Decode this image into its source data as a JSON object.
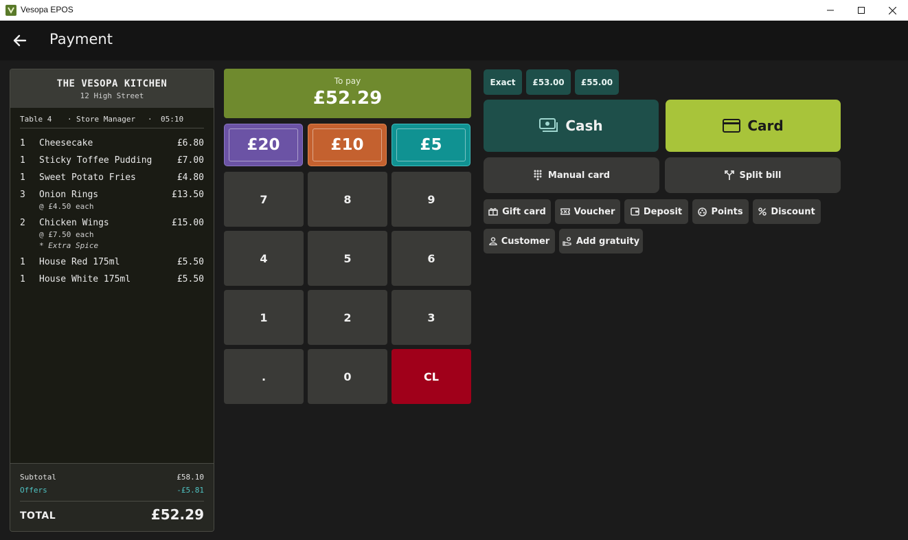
{
  "window": {
    "title": "Vesopa EPOS"
  },
  "header": {
    "title": "Payment"
  },
  "receipt": {
    "restaurant": "THE VESOPA KITCHEN",
    "address": "12 High Street",
    "table": "Table 4",
    "separator": "·",
    "staff": "Store Manager",
    "time": "05:10",
    "items": [
      {
        "qty": "1",
        "name": "Cheesecake",
        "price": "£6.80"
      },
      {
        "qty": "1",
        "name": "Sticky Toffee Pudding",
        "price": "£7.00"
      },
      {
        "qty": "1",
        "name": "Sweet Potato Fries",
        "price": "£4.80"
      },
      {
        "qty": "3",
        "name": "Onion Rings",
        "price": "£13.50",
        "each": "@ £4.50 each"
      },
      {
        "qty": "2",
        "name": "Chicken Wings",
        "price": "£15.00",
        "each": "@ £7.50 each",
        "modifier": "* Extra Spice"
      },
      {
        "qty": "1",
        "name": "House Red 175ml",
        "price": "£5.50"
      },
      {
        "qty": "1",
        "name": "House White 175ml",
        "price": "£5.50"
      }
    ],
    "subtotal_label": "Subtotal",
    "subtotal": "£58.10",
    "offers_label": "Offers",
    "offers": "-£5.81",
    "total_label": "TOTAL",
    "total": "£52.29"
  },
  "to_pay": {
    "label": "To pay",
    "amount": "£52.29"
  },
  "notes": [
    "£20",
    "£10",
    "£5"
  ],
  "keypad": [
    "7",
    "8",
    "9",
    "4",
    "5",
    "6",
    "1",
    "2",
    "3",
    ".",
    "0",
    "CL"
  ],
  "quick_amounts": [
    "Exact",
    "£53.00",
    "£55.00"
  ],
  "methods": {
    "cash": "Cash",
    "card": "Card"
  },
  "actions": {
    "manual_card": "Manual card",
    "split_bill": "Split bill"
  },
  "options": {
    "gift_card": "Gift card",
    "voucher": "Voucher",
    "deposit": "Deposit",
    "points": "Points",
    "discount": "Discount",
    "customer": "Customer",
    "add_gratuity": "Add gratuity"
  },
  "colors": {
    "to_pay": "#6f8a2e",
    "note_20": "#6b53a5",
    "note_10": "#c4612f",
    "note_5": "#109292",
    "cash": "#1e4f4a",
    "card": "#a8c43a",
    "clear": "#a0001a",
    "offers": "#4fc3c3"
  }
}
